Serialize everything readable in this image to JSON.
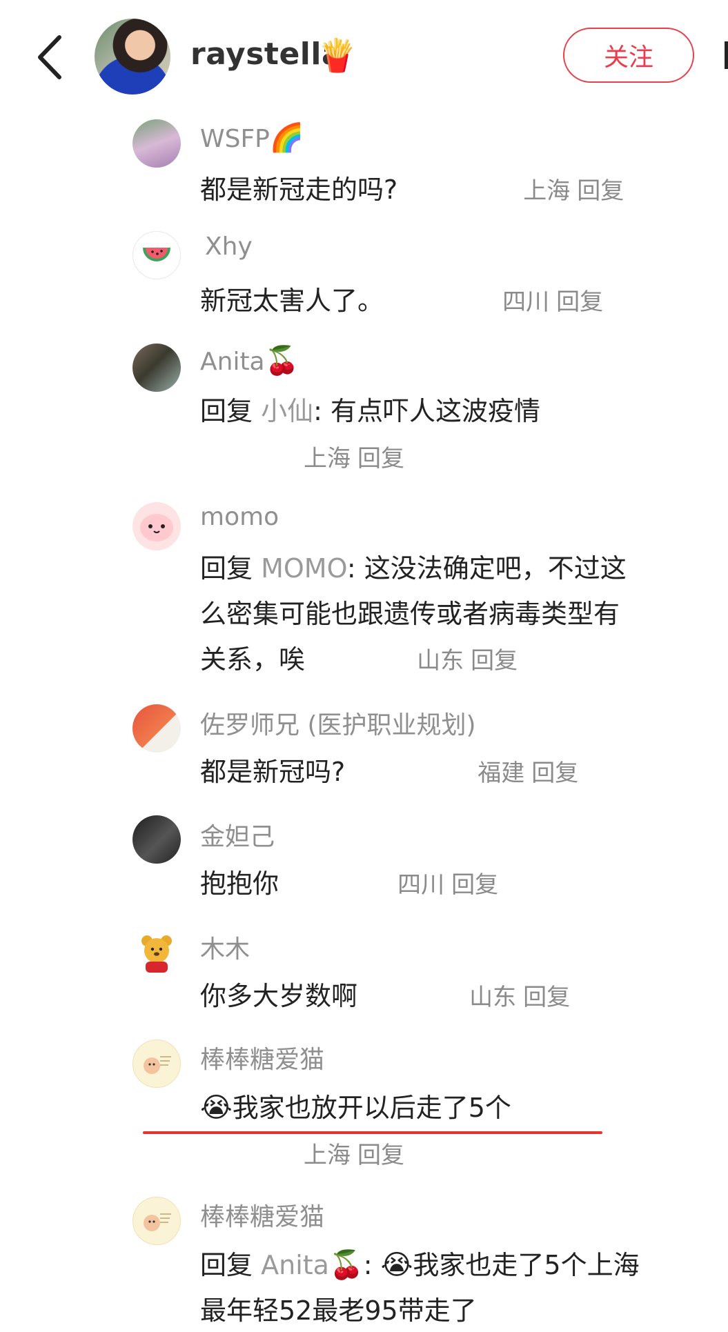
{
  "header": {
    "username": "raystella",
    "username_emoji": "🍟",
    "follow_label": "关注"
  },
  "comments": [
    {
      "name": "WSFP",
      "name_emoji": "🌈",
      "avatar_icon": "character-doll-avatar",
      "text": "都是新冠走的吗?",
      "location": "上海",
      "reply_label": "回复"
    },
    {
      "name": "Xhy",
      "avatar_icon": "watermelon-avatar",
      "text": "新冠太害人了。",
      "location": "四川",
      "reply_label": "回复"
    },
    {
      "name": "Anita",
      "name_emoji": "🍒",
      "avatar_icon": "photo-avatar",
      "reply_prefix": "回复",
      "reply_to": "小仙",
      "text": ": 有点吓人这波疫情",
      "location": "上海",
      "reply_label": "回复"
    },
    {
      "name": "momo",
      "avatar_icon": "pink-cartoon-avatar",
      "reply_prefix": "回复",
      "reply_to": "MOMO",
      "text_lines": [
        ": 这没法确定吧，不过这",
        "么密集可能也跟遗传或者病毒类型有",
        "关系，唉"
      ],
      "location": "山东",
      "reply_label": "回复"
    },
    {
      "name": "佐罗师兄 (医护职业规划)",
      "avatar_icon": "peach-panda-avatar",
      "text": "都是新冠吗?",
      "location": "福建",
      "reply_label": "回复"
    },
    {
      "name": "金妲己",
      "avatar_icon": "dark-photo-avatar",
      "text": "抱抱你",
      "location": "四川",
      "reply_label": "回复"
    },
    {
      "name": "木木",
      "avatar_icon": "winnie-the-pooh-avatar",
      "text": "你多大岁数啊",
      "location": "山东",
      "reply_label": "回复"
    },
    {
      "name": "棒棒糖爱猫",
      "avatar_icon": "cartoon-cat-avatar",
      "text_emoji": "😭",
      "text": "我家也放开以后走了5个",
      "location": "上海",
      "reply_label": "回复"
    },
    {
      "name": "棒棒糖爱猫",
      "avatar_icon": "cartoon-cat-avatar",
      "reply_prefix": "回复",
      "reply_to": "Anita",
      "reply_to_emoji": "🍒",
      "text_emoji": "😭",
      "text_lines": [
        "我家也走了5个上海",
        "最年轻52最老95带走了"
      ]
    }
  ],
  "colors": {
    "accent": "#ea3d4b",
    "underline": "#e8322e",
    "muted": "#8f8f8f"
  }
}
